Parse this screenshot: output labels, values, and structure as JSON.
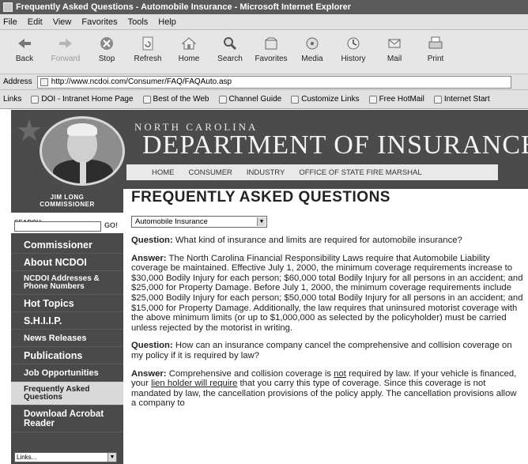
{
  "window": {
    "title": "Frequently Asked Questions - Automobile Insurance - Microsoft Internet Explorer"
  },
  "menu": [
    "File",
    "Edit",
    "View",
    "Favorites",
    "Tools",
    "Help"
  ],
  "toolbar": {
    "back": "Back",
    "forward": "Forward",
    "stop": "Stop",
    "refresh": "Refresh",
    "home": "Home",
    "search": "Search",
    "favorites": "Favorites",
    "media": "Media",
    "history": "History",
    "mail": "Mail",
    "print": "Print"
  },
  "address": {
    "label": "Address",
    "url": "http://www.ncdoi.com/Consumer/FAQ/FAQAuto.asp"
  },
  "links": {
    "label": "Links",
    "items": [
      "DOI - Intranet Home Page",
      "Best of the Web",
      "Channel Guide",
      "Customize Links",
      "Free HotMail",
      "Internet Start"
    ]
  },
  "banner": {
    "state": "NORTH CAROLINA",
    "department": "DEPARTMENT OF INSURANCE",
    "nav": [
      "HOME",
      "CONSUMER",
      "INDUSTRY",
      "OFFICE OF STATE FIRE MARSHAL"
    ]
  },
  "sidebar": {
    "commissioner_name": "JIM LONG",
    "commissioner_role": "COMMISSIONER",
    "search_label": "SEARCH:",
    "search_go": "GO!",
    "items": [
      "Commissioner",
      "About NCDOI",
      "NCDOI Addresses & Phone Numbers",
      "Hot Topics",
      "S.H.I.I.P.",
      "News Releases",
      "Publications",
      "Job Opportunities",
      "Frequently Asked Questions",
      "Download Acrobat Reader"
    ],
    "links_select": "Links..."
  },
  "main": {
    "title": "FREQUENTLY ASKED QUESTIONS",
    "topic": "Automobile Insurance",
    "q1_label": "Question:",
    "q1": "What kind of insurance and limits are required for automobile insurance?",
    "a1_label": "Answer:",
    "a1": "The North Carolina Financial Responsibility Laws require that Automobile Liability coverage be maintained. Effective July 1, 2000, the minimum coverage requirements increase to $30,000 Bodily Injury for each person; $60,000 total Bodily Injury for all persons in an accident; and $25,000 for Property Damage. Before July 1, 2000, the minimum coverage requirements include $25,000 Bodily Injury for each person; $50,000 total Bodily Injury for all persons in an accident; and $15,000 for Property Damage. Additionally, the law requires that uninsured motorist coverage with the above minimum limits (or up to $1,000,000 as selected by the policyholder) must be carried unless rejected by the motorist in writing.",
    "q2_label": "Question:",
    "q2": "How can an insurance company cancel the comprehensive and collision coverage on my policy if it is required by law?",
    "a2_label": "Answer:",
    "a2_part1": "Comprehensive and collision coverage is",
    "a2_not": "not",
    "a2_part2": "required by law. If your vehicle is financed, your",
    "a2_link": "lien holder will require",
    "a2_part3": "that you carry this type of coverage. Since this coverage is not mandated by law, the cancellation provisions of the policy apply. The cancellation provisions allow a company to"
  }
}
